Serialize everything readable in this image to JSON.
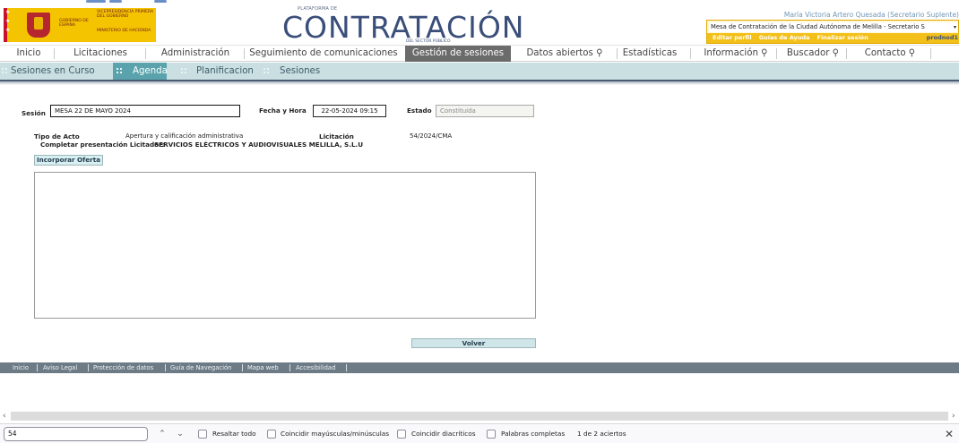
{
  "header": {
    "gov_line1": "Vicepresidencia Primera del Gobierno",
    "gov_line2": "Ministerio de Hacienda",
    "gov_name": "Gobierno de España",
    "brand_small": "PLATAFORMA DE",
    "brand_big": "CONTRATACIÓN",
    "brand_sub": "DEL SECTOR PÚBLICO",
    "user_name": "María Victoria Artero Quesada (Secretario Suplente)",
    "mesa_select": "Mesa de Contratación de la Ciudad Autónoma de Melilla - Secretario S",
    "links": [
      "Editar perfil",
      "Guías de Ayuda",
      "Finalizar sesión"
    ],
    "env_label": "prodnod1"
  },
  "mainnav": {
    "items": [
      {
        "label": "Inicio"
      },
      {
        "label": "Licitaciones"
      },
      {
        "label": "Administración"
      },
      {
        "label": "Seguimiento de comunicaciones"
      },
      {
        "label": "Gestión de sesiones"
      },
      {
        "label": "Datos abiertos ⚲"
      },
      {
        "label": "Estadísticas"
      },
      {
        "label": "Información ⚲"
      },
      {
        "label": "Buscador ⚲"
      },
      {
        "label": "Contacto ⚲"
      }
    ],
    "active": "Gestión de sesiones"
  },
  "subnav": {
    "items": [
      {
        "label": "Sesiones en Curso"
      },
      {
        "label": "Agenda"
      },
      {
        "label": "Planificacion"
      },
      {
        "label": "Sesiones"
      }
    ],
    "active": "Agenda"
  },
  "form": {
    "sesion_label": "Sesión",
    "sesion_value": "MESA 22 DE MAYO 2024",
    "fecha_label": "Fecha y Hora",
    "fecha_value": "22-05-2024 09:15",
    "estado_label": "Estado",
    "estado_value": "Constituida",
    "tipo_label": "Tipo de Acto",
    "tipo_value": "Apertura y calificación administrativa",
    "licitacion_label": "Licitación",
    "licitacion_value": "54/2024/CMA",
    "completar_label": "Completar presentación Licitador:",
    "completar_value": "SERVICIOS ELÉCTRICOS Y AUDIOVISUALES MELILLA, S.L.U",
    "incorporar_button": "Incorporar Oferta",
    "volver_button": "Volver"
  },
  "footer": {
    "links": [
      "Inicio",
      "Aviso Legal",
      "Protección de datos",
      "Guía de Navegación",
      "Mapa web",
      "Accesibilidad"
    ]
  },
  "findbar": {
    "query": "54",
    "options": [
      "Resaltar todo",
      "Coincidir mayúsculas/minúsculas",
      "Coincidir diacríticos",
      "Palabras completas"
    ],
    "result": "1 de 2 aciertos"
  },
  "colors": {
    "gov_yellow": "#f5c400",
    "brand_blue": "#3a4e7a",
    "nav_active": "#6b6b6b",
    "subnav_bg": "#c9dfe1",
    "subnav_active": "#5aa3ad",
    "footer_bg": "#6d7b86"
  },
  "icons": {
    "close": "close-icon",
    "up": "chevron-up-icon",
    "down": "chevron-down-icon"
  }
}
